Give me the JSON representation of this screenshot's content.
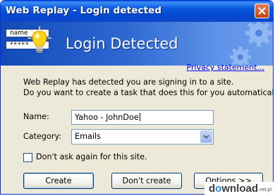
{
  "window": {
    "title": "Web Replay - Login detected"
  },
  "banner": {
    "title": "Login Detected",
    "mini_name_label": "name",
    "mini_password_mask": "*****"
  },
  "links": {
    "privacy": "Privacy statement..."
  },
  "message": {
    "line1": "Web Replay has detected you are signing in to a site.",
    "line2": "Do you want to create a task that does this for you automatically?"
  },
  "form": {
    "name_label": "Name:",
    "name_value": "Yahoo - JohnDoe",
    "category_label": "Category:",
    "category_value": "Emails",
    "dont_ask_label": "Don't ask again for this site.",
    "dont_ask_checked": false
  },
  "buttons": {
    "create": "Create",
    "dont_create": "Don't create",
    "options": "Options >>"
  },
  "watermark": {
    "prefix": "d",
    "o": "o",
    "suffix": "wnload",
    "tld": ".net.pl"
  },
  "colors": {
    "title_bar": "#0A5AE0",
    "banner_start": "#124BB8",
    "banner_end": "#6E9EEC",
    "dialog_face": "#ECE9D8",
    "link": "#0000FF",
    "close_button": "#C2410F"
  },
  "icons": [
    "close-icon",
    "lightbulb-icon",
    "gears-icon",
    "dropdown-arrow-icon"
  ]
}
